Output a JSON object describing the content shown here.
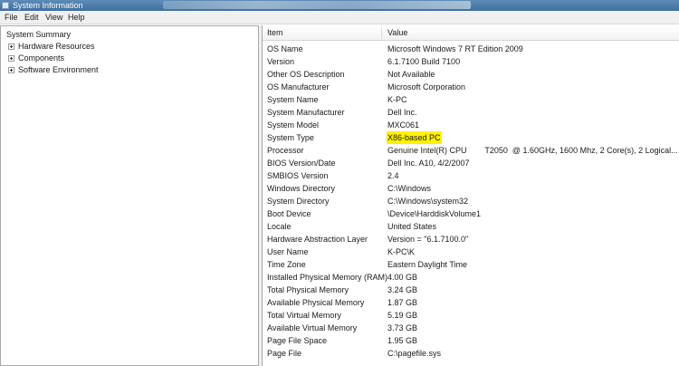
{
  "window": {
    "title": "System Information"
  },
  "menu": [
    "File",
    "Edit",
    "View",
    "Help"
  ],
  "tree": {
    "root": "System Summary",
    "children": [
      "Hardware Resources",
      "Components",
      "Software Environment"
    ]
  },
  "table": {
    "columns": [
      "Item",
      "Value"
    ],
    "rows": [
      {
        "item": "OS Name",
        "value": "Microsoft Windows 7 RT Edition 2009"
      },
      {
        "item": "Version",
        "value": "6.1.7100 Build 7100"
      },
      {
        "item": "Other OS Description",
        "value": "Not Available"
      },
      {
        "item": "OS Manufacturer",
        "value": "Microsoft Corporation"
      },
      {
        "item": "System Name",
        "value": "K-PC"
      },
      {
        "item": "System Manufacturer",
        "value": "Dell Inc."
      },
      {
        "item": "System Model",
        "value": "MXC061"
      },
      {
        "item": "System Type",
        "value": "X86-based PC"
      },
      {
        "item": "Processor",
        "value": "Genuine Intel(R) CPU        T2050  @ 1.60GHz, 1600 Mhz, 2 Core(s), 2 Logical..."
      },
      {
        "item": "BIOS Version/Date",
        "value": "Dell Inc. A10, 4/2/2007"
      },
      {
        "item": "SMBIOS Version",
        "value": "2.4"
      },
      {
        "item": "Windows Directory",
        "value": "C:\\Windows"
      },
      {
        "item": "System Directory",
        "value": "C:\\Windows\\system32"
      },
      {
        "item": "Boot Device",
        "value": "\\Device\\HarddiskVolume1"
      },
      {
        "item": "Locale",
        "value": "United States"
      },
      {
        "item": "Hardware Abstraction Layer",
        "value": "Version = \"6.1.7100.0\""
      },
      {
        "item": "User Name",
        "value": "K-PC\\K"
      },
      {
        "item": "Time Zone",
        "value": "Eastern Daylight Time"
      },
      {
        "item": "Installed Physical Memory (RAM)",
        "value": "4.00 GB"
      },
      {
        "item": "Total Physical Memory",
        "value": "3.24 GB"
      },
      {
        "item": "Available Physical Memory",
        "value": "1.87 GB"
      },
      {
        "item": "Total Virtual Memory",
        "value": "5.19 GB"
      },
      {
        "item": "Available Virtual Memory",
        "value": "3.73 GB"
      },
      {
        "item": "Page File Space",
        "value": "1.95 GB"
      },
      {
        "item": "Page File",
        "value": "C:\\pagefile.sys"
      }
    ]
  },
  "colors": {
    "highlight": "#fff200",
    "titlebar": "#4a7aa8"
  },
  "icons": {
    "app": "app-icon",
    "expand": "plus-expander-icon"
  }
}
